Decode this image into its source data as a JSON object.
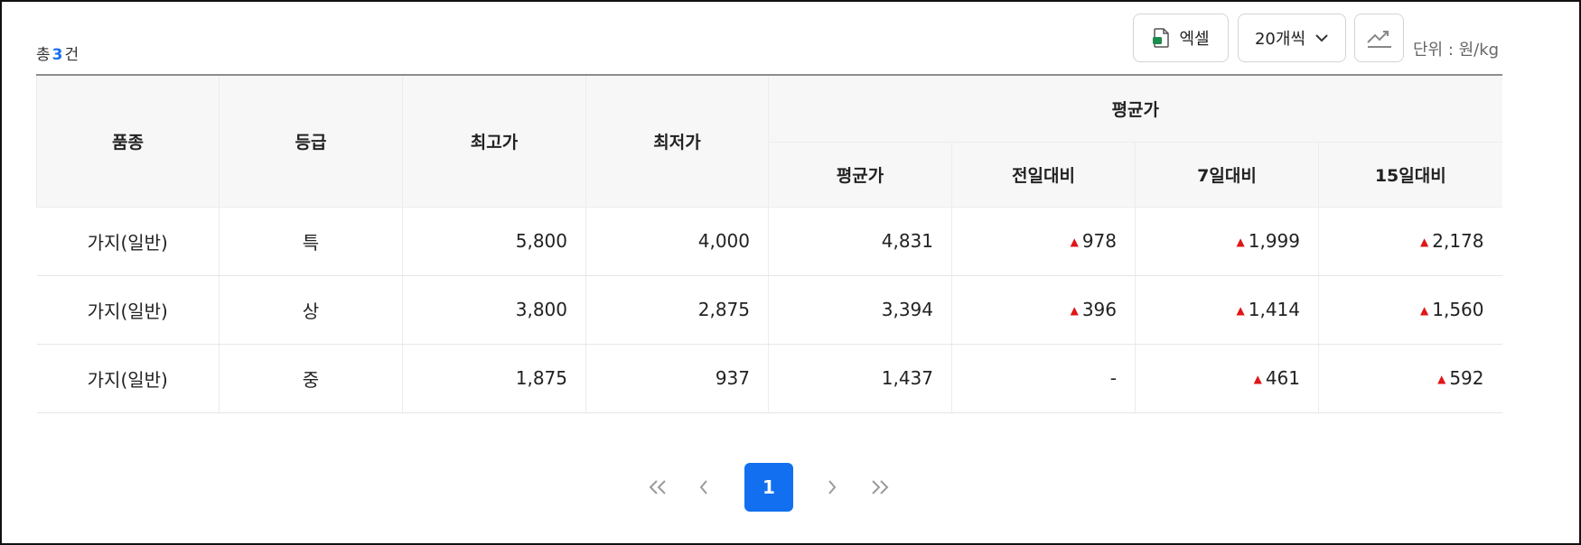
{
  "summary": {
    "prefix": "총",
    "count": "3",
    "suffix": "건"
  },
  "toolbar": {
    "excel_label": "엑셀",
    "rows_label": "20개씩",
    "unit_label": "단위 : 원/kg"
  },
  "table": {
    "headers": {
      "variety": "품종",
      "grade": "등급",
      "max": "최고가",
      "min": "최저가",
      "avg_group": "평균가",
      "avg": "평균가",
      "vs_prev_day": "전일대비",
      "vs_7day": "7일대비",
      "vs_15day": "15일대비"
    },
    "rows": [
      {
        "variety": "가지(일반)",
        "grade": "특",
        "max": "5,800",
        "min": "4,000",
        "avg": "4,831",
        "vs_prev_day": "978",
        "vs_7day": "1,999",
        "vs_15day": "2,178"
      },
      {
        "variety": "가지(일반)",
        "grade": "상",
        "max": "3,800",
        "min": "2,875",
        "avg": "3,394",
        "vs_prev_day": "396",
        "vs_7day": "1,414",
        "vs_15day": "1,560"
      },
      {
        "variety": "가지(일반)",
        "grade": "중",
        "max": "1,875",
        "min": "937",
        "avg": "1,437",
        "vs_prev_day": "-",
        "vs_7day": "461",
        "vs_15day": "592"
      }
    ]
  },
  "pagination": {
    "first": "«",
    "prev": "‹",
    "current": "1",
    "next": "›",
    "last": "»"
  },
  "colors": {
    "accent": "#1270f0",
    "count": "#1b6ef3",
    "up": "#e01616",
    "excel_icon": "#1d8a4e"
  }
}
